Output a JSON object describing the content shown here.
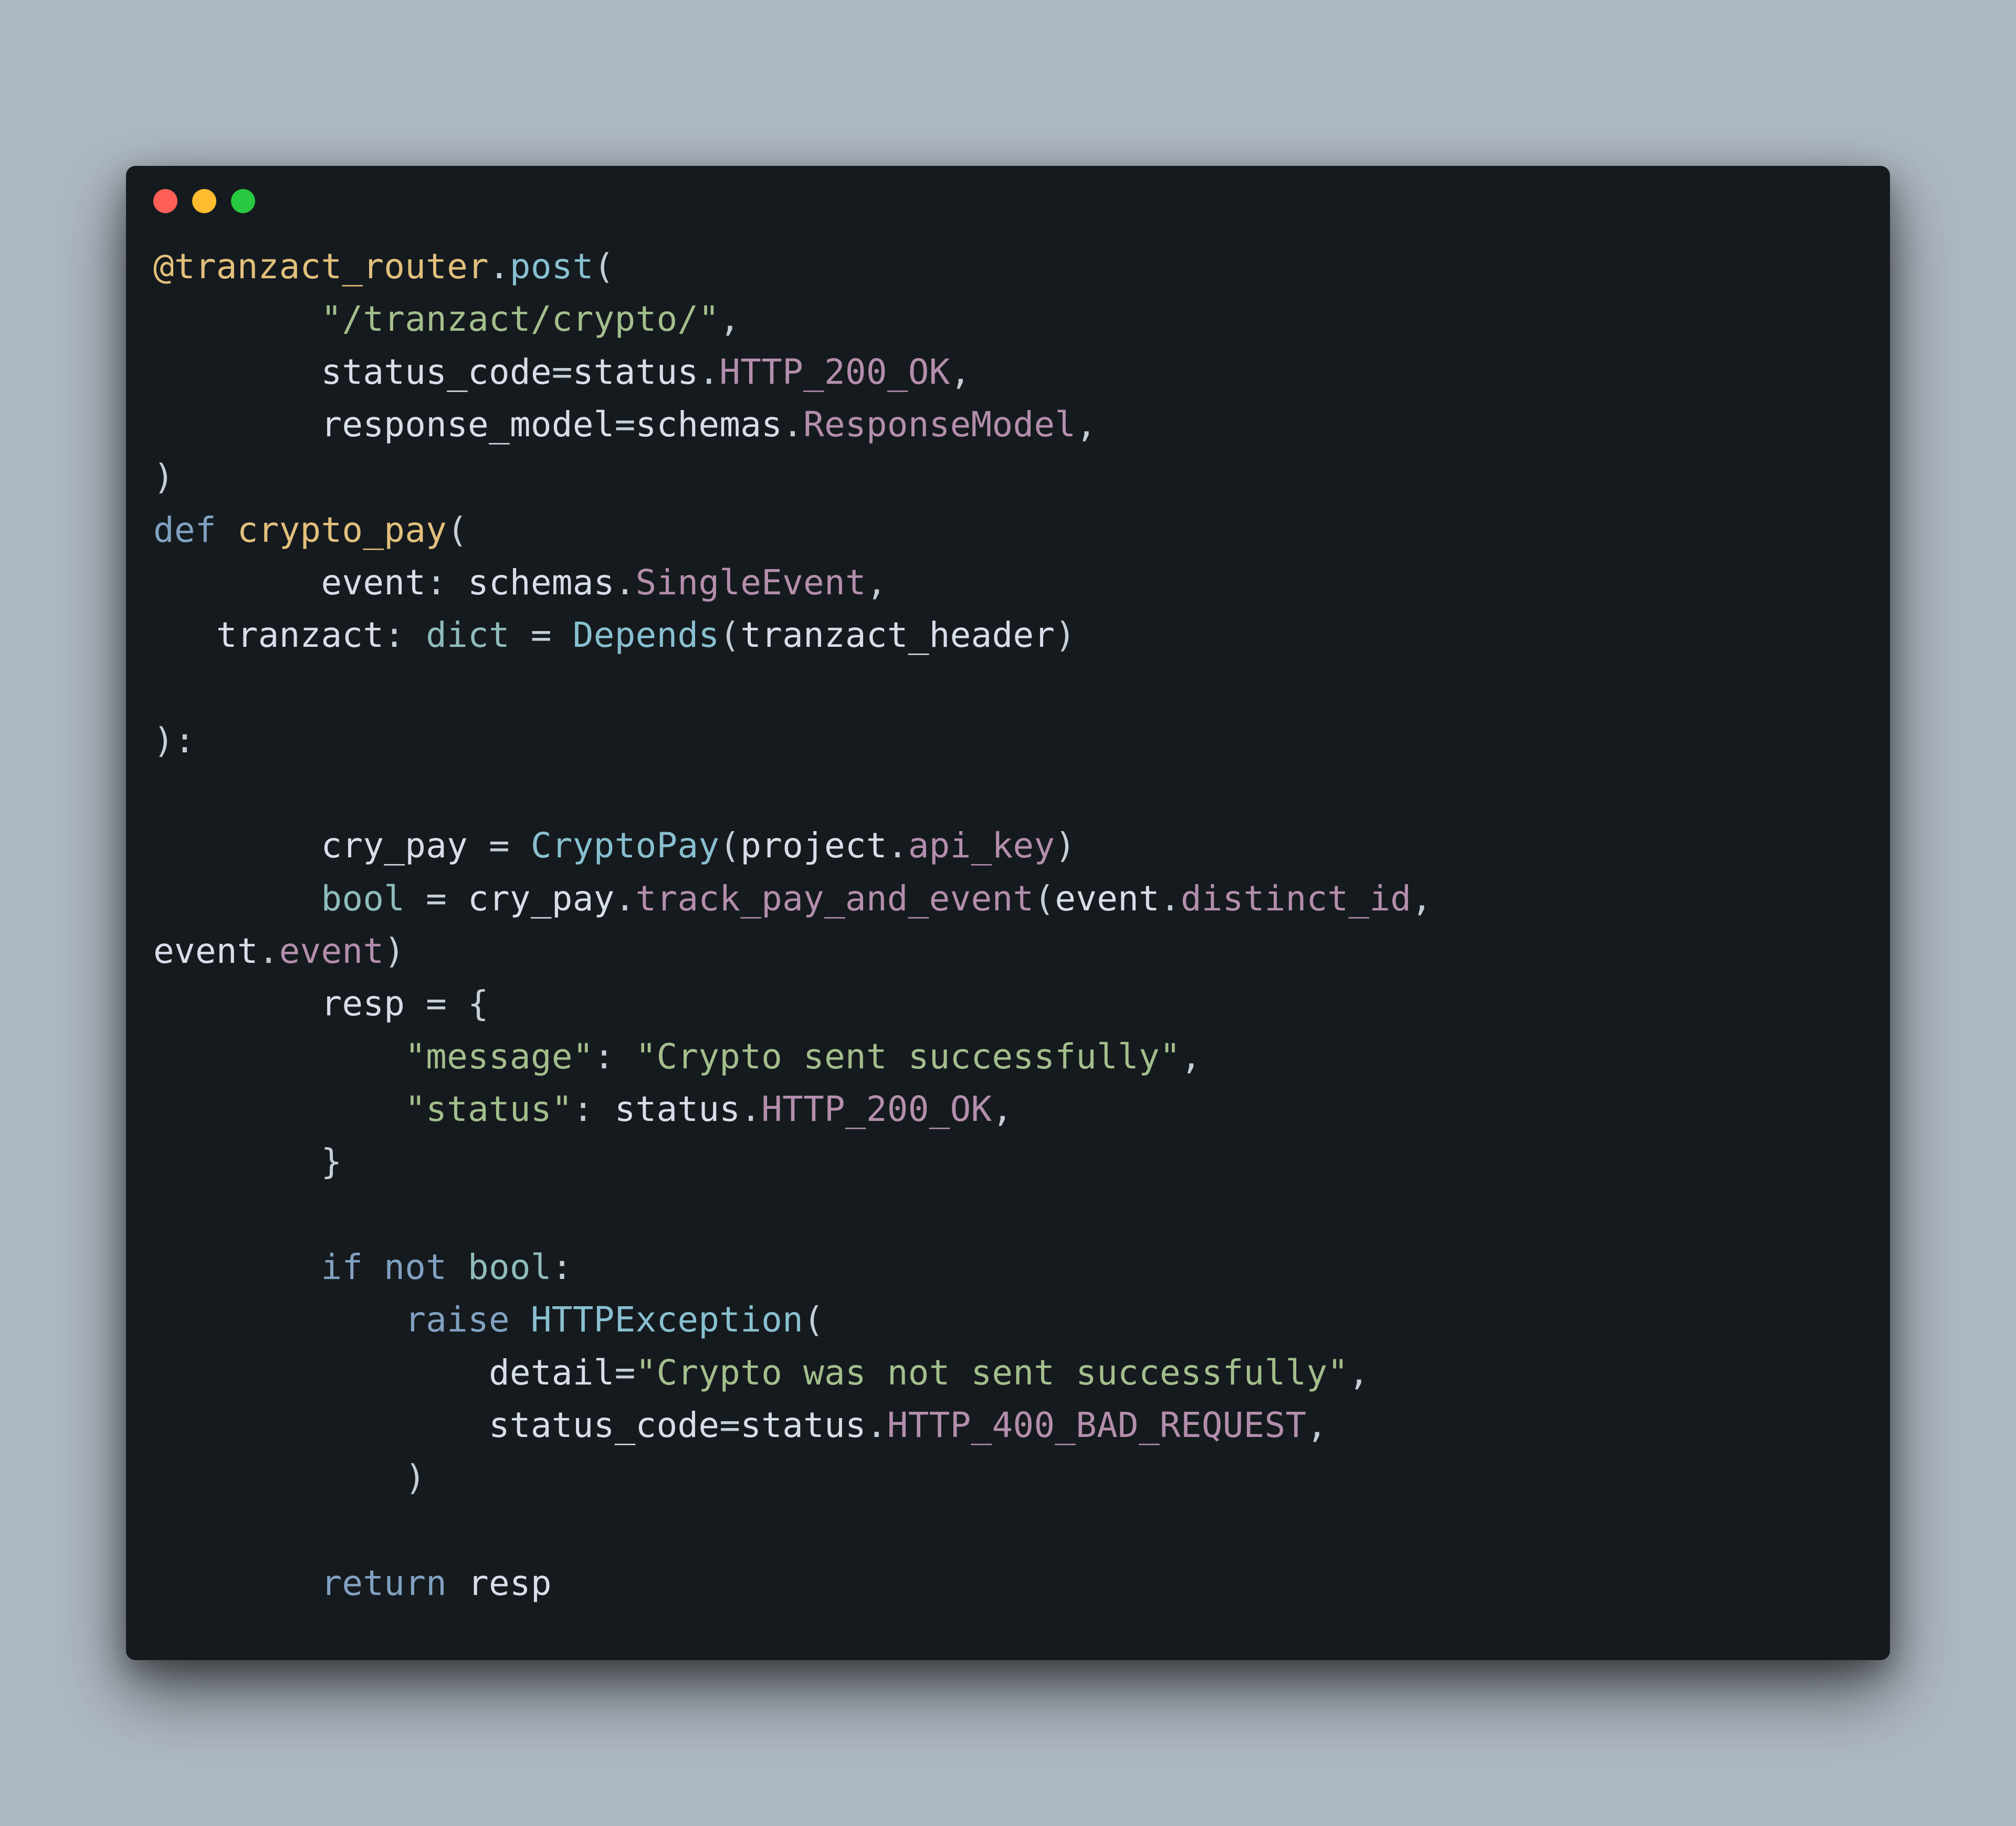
{
  "colors": {
    "bg_page": "#aeb8c2",
    "bg_window": "#151a1e",
    "traffic_red": "#ff5f57",
    "traffic_yellow": "#febc2e",
    "traffic_green": "#28c840",
    "text_default": "#c5ced6",
    "syntax_keyword": "#81a1c1",
    "syntax_string": "#a3be8c",
    "syntax_member": "#b48ead",
    "syntax_fn": "#88c0d0",
    "syntax_type": "#8fbcbb",
    "syntax_yellow": "#e2c07c"
  },
  "code": {
    "l1a": "@tranzact_router",
    "l1b": ".",
    "l1c": "post",
    "l1d": "(",
    "l2a": "        ",
    "l2b": "\"/tranzact/crypto/\"",
    "l2c": ",",
    "l3a": "        ",
    "l3b": "status_code",
    "l3c": "=",
    "l3d": "status",
    "l3e": ".",
    "l3f": "HTTP_200_OK",
    "l3g": ",",
    "l4a": "        ",
    "l4b": "response_model",
    "l4c": "=",
    "l4d": "schemas",
    "l4e": ".",
    "l4f": "ResponseModel",
    "l4g": ",",
    "l5a": ")",
    "l6a": "def ",
    "l6b": "crypto_pay",
    "l6c": "(",
    "l7a": "        ",
    "l7b": "event",
    "l7c": ": ",
    "l7d": "schemas",
    "l7e": ".",
    "l7f": "SingleEvent",
    "l7g": ",",
    "l8a": "   ",
    "l8b": "tranzact",
    "l8c": ": ",
    "l8d": "dict",
    "l8e": " = ",
    "l8f": "Depends",
    "l8g": "(",
    "l8h": "tranzact_header",
    "l8i": ")",
    "l9": "",
    "l10a": ")",
    "l10b": ":",
    "l11": "",
    "l12a": "        ",
    "l12b": "cry_pay",
    "l12c": " = ",
    "l12d": "CryptoPay",
    "l12e": "(",
    "l12f": "project",
    "l12g": ".",
    "l12h": "api_key",
    "l12i": ")",
    "l13a": "        ",
    "l13b": "bool",
    "l13c": " = ",
    "l13d": "cry_pay",
    "l13e": ".",
    "l13f": "track_pay_and_event",
    "l13g": "(",
    "l13h": "event",
    "l13i": ".",
    "l13j": "distinct_id",
    "l13k": ", ",
    "l14a": "event",
    "l14b": ".",
    "l14c": "event",
    "l14d": ")",
    "l15a": "        ",
    "l15b": "resp",
    "l15c": " = {",
    "l16a": "            ",
    "l16b": "\"message\"",
    "l16c": ": ",
    "l16d": "\"Crypto sent successfully\"",
    "l16e": ",",
    "l17a": "            ",
    "l17b": "\"status\"",
    "l17c": ": ",
    "l17d": "status",
    "l17e": ".",
    "l17f": "HTTP_200_OK",
    "l17g": ",",
    "l18a": "        }",
    "l19": "",
    "l20a": "        ",
    "l20b": "if",
    "l20c": " ",
    "l20d": "not",
    "l20e": " ",
    "l20f": "bool",
    "l20g": ":",
    "l21a": "            ",
    "l21b": "raise",
    "l21c": " ",
    "l21d": "HTTPException",
    "l21e": "(",
    "l22a": "                ",
    "l22b": "detail",
    "l22c": "=",
    "l22d": "\"Crypto was not sent successfully\"",
    "l22e": ",",
    "l23a": "                ",
    "l23b": "status_code",
    "l23c": "=",
    "l23d": "status",
    "l23e": ".",
    "l23f": "HTTP_400_BAD_REQUEST",
    "l23g": ",",
    "l24a": "            )",
    "l25": "",
    "l26a": "        ",
    "l26b": "return",
    "l26c": " ",
    "l26d": "resp"
  }
}
